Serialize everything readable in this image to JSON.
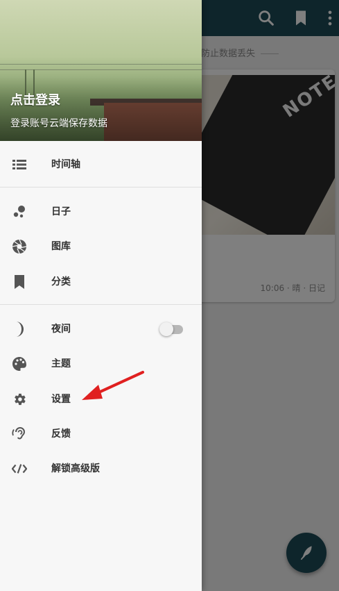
{
  "app": {
    "notice": "防止数据丢失",
    "entry_meta": "10:06 · 晴 · 日记",
    "notebook_text": "NOTE"
  },
  "drawer": {
    "header": {
      "title": "点击登录",
      "subtitle": "登录账号云端保存数据"
    },
    "items": [
      {
        "label": "时间轴",
        "icon": "timeline-list-icon"
      },
      {
        "label": "日子",
        "icon": "days-dots-icon"
      },
      {
        "label": "图库",
        "icon": "gallery-aperture-icon"
      },
      {
        "label": "分类",
        "icon": "category-bookmark-icon"
      },
      {
        "label": "夜间",
        "icon": "night-moon-icon",
        "toggle_on": false
      },
      {
        "label": "主题",
        "icon": "theme-palette-icon"
      },
      {
        "label": "设置",
        "icon": "settings-gear-icon"
      },
      {
        "label": "反馈",
        "icon": "feedback-ear-icon"
      },
      {
        "label": "解锁高级版",
        "icon": "unlock-premium-code-icon"
      }
    ]
  },
  "colors": {
    "toolbar": "#1c4a57",
    "annotation_arrow": "#e02020",
    "drawer_bg": "#f7f7f7",
    "label_text": "#333333",
    "icon": "#555555"
  }
}
